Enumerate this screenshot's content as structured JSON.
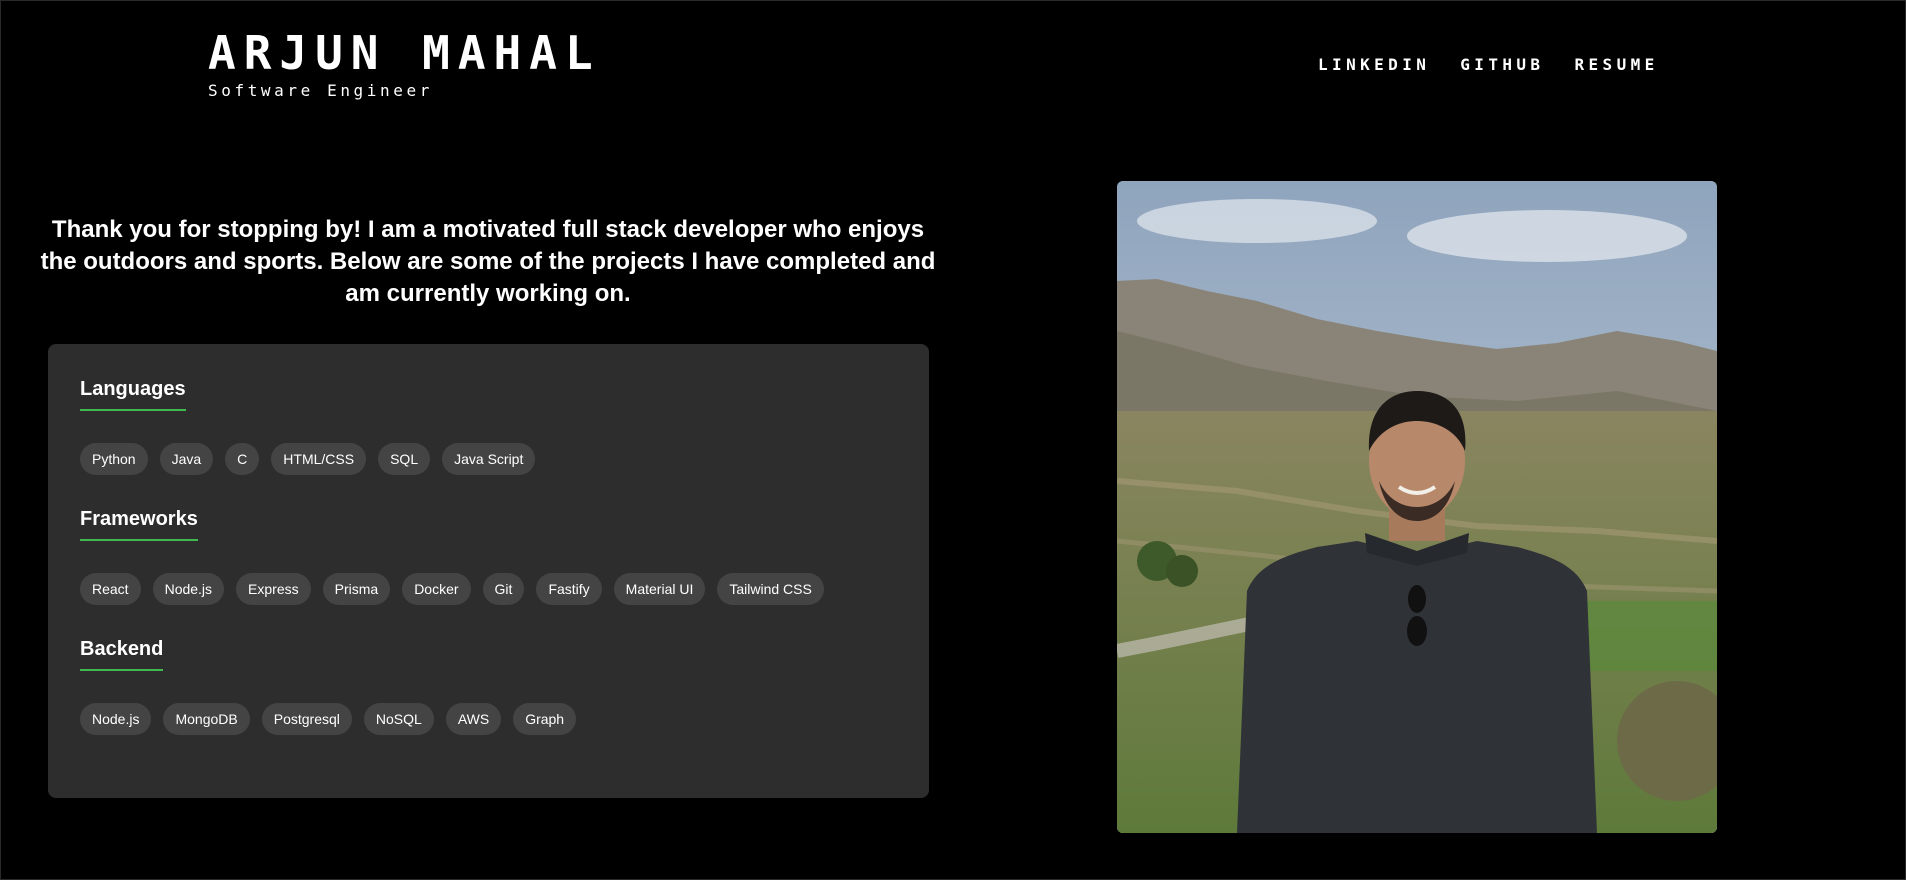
{
  "header": {
    "name": "ARJUN MAHAL",
    "title": "Software Engineer"
  },
  "nav": {
    "linkedin": "LINKEDIN",
    "github": "GITHUB",
    "resume": "RESUME"
  },
  "intro": {
    "text": "Thank you for stopping by! I am a motivated full stack developer who enjoys the outdoors and sports. Below are some of the projects I have completed and am currently working on."
  },
  "skills": {
    "languages": {
      "title": "Languages",
      "items": [
        "Python",
        "Java",
        "C",
        "HTML/CSS",
        "SQL",
        "Java Script"
      ]
    },
    "frameworks": {
      "title": "Frameworks",
      "items": [
        "React",
        "Node.js",
        "Express",
        "Prisma",
        "Docker",
        "Git",
        "Fastify",
        "Material UI",
        "Tailwind CSS"
      ]
    },
    "backend": {
      "title": "Backend",
      "items": [
        "Node.js",
        "MongoDB",
        "Postgresql",
        "NoSQL",
        "AWS",
        "Graph"
      ]
    }
  },
  "colors": {
    "background": "#000000",
    "card": "#2d2d2d",
    "chip": "#444444",
    "accent": "#3fb950"
  }
}
